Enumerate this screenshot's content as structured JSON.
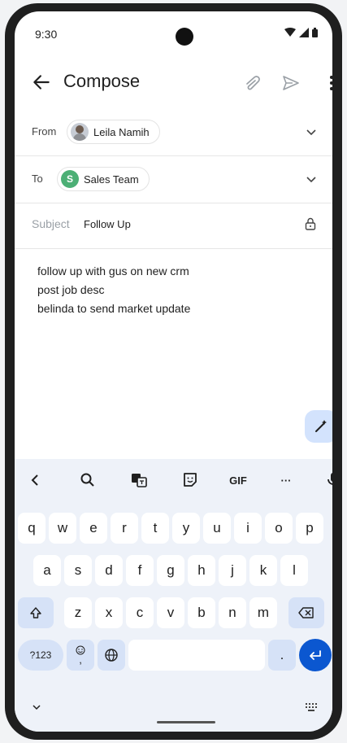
{
  "status": {
    "time": "9:30"
  },
  "appbar": {
    "title": "Compose"
  },
  "from": {
    "label": "From",
    "name": "Leila Namih"
  },
  "to": {
    "label": "To",
    "name": "Sales Team",
    "avatar_letter": "S"
  },
  "subject": {
    "placeholder": "Subject",
    "value": "Follow Up"
  },
  "body": {
    "lines": [
      "follow up with gus on new crm",
      "post job desc",
      "belinda to send market update"
    ]
  },
  "keyboard": {
    "gif_label": "GIF",
    "more_label": "···",
    "row1": [
      "q",
      "w",
      "e",
      "r",
      "t",
      "y",
      "u",
      "i",
      "o",
      "p"
    ],
    "row2": [
      "a",
      "s",
      "d",
      "f",
      "g",
      "h",
      "j",
      "k",
      "l"
    ],
    "row3": [
      "z",
      "x",
      "c",
      "v",
      "b",
      "n",
      "m"
    ],
    "symbols_label": "?123",
    "emoji_comma": ",",
    "period": "."
  },
  "colors": {
    "accent": "#0b57d0",
    "chip_green": "#4caf75",
    "keyboard_bg": "#eef2f9",
    "mod_key": "#d6e2f7"
  }
}
